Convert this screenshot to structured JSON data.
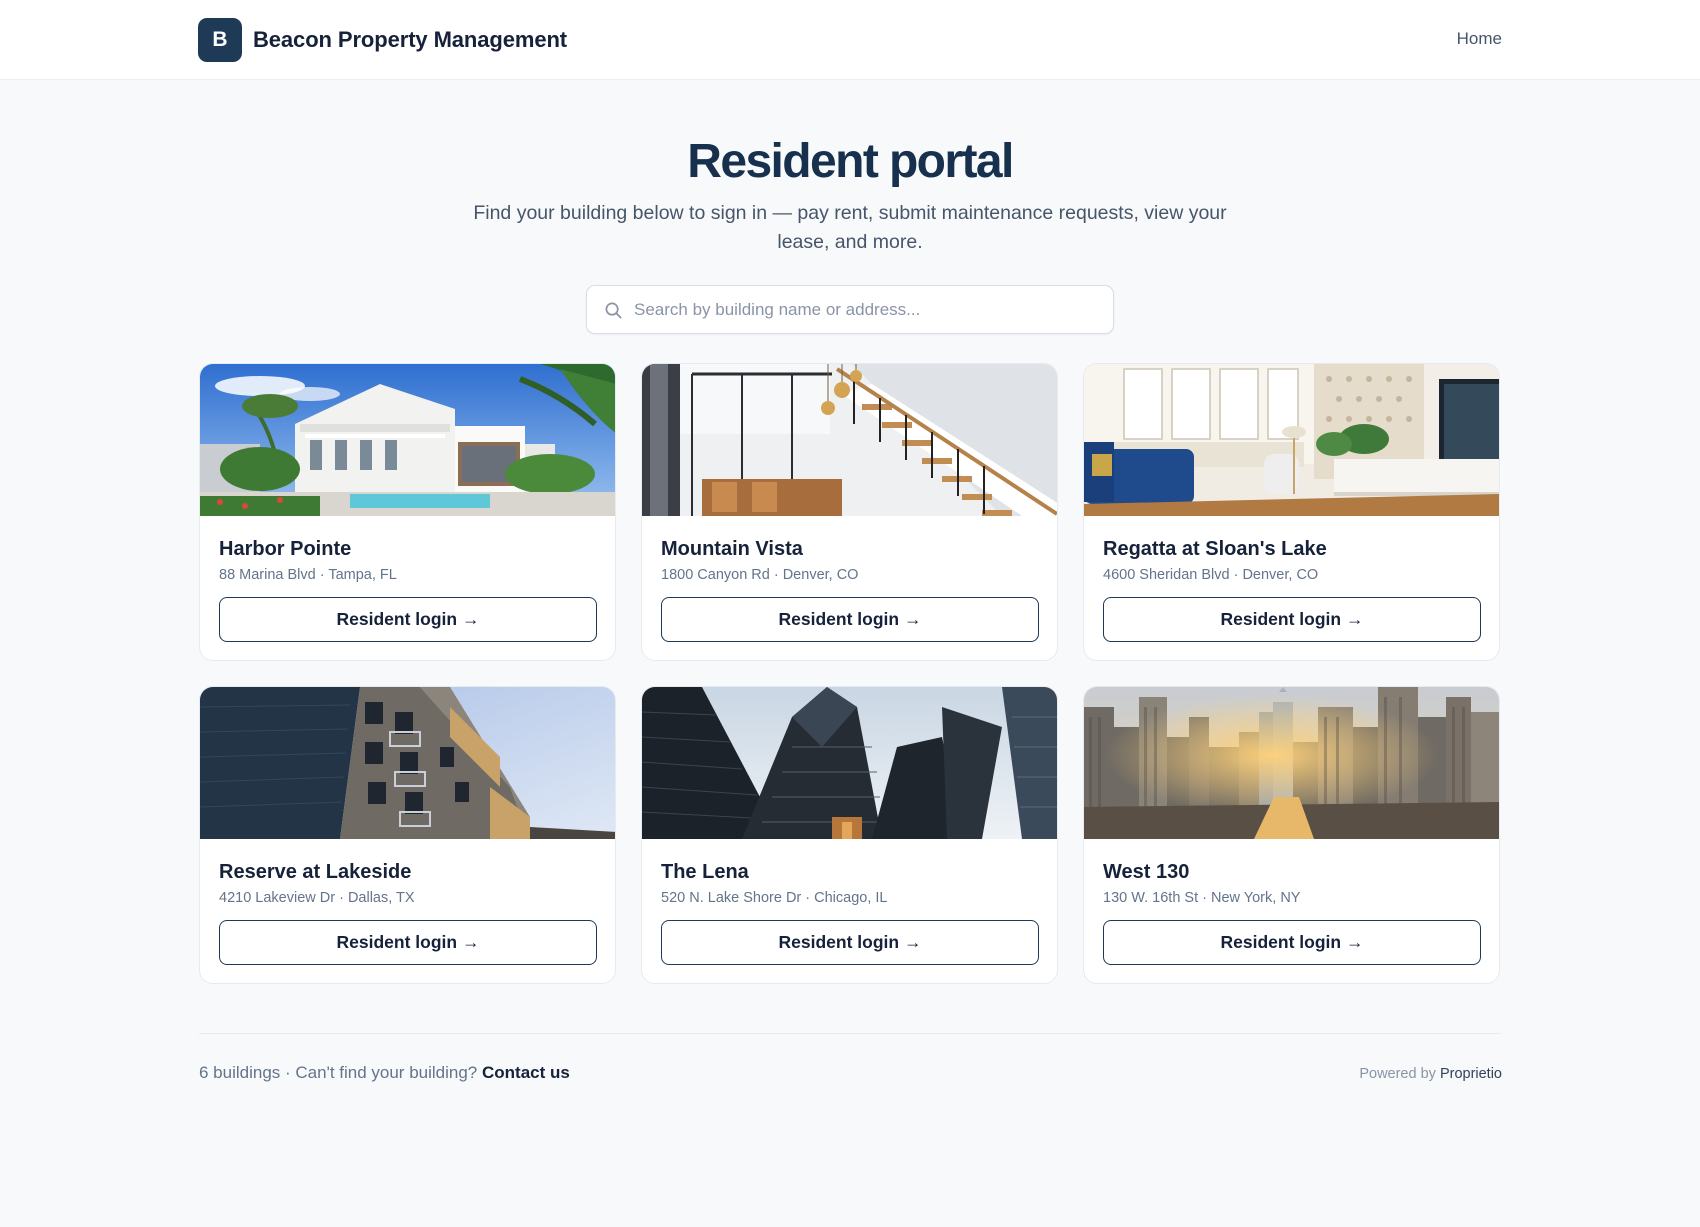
{
  "header": {
    "logo_letter": "B",
    "brand_name": "Beacon Property Management",
    "nav_home": "Home"
  },
  "hero": {
    "title": "Resident portal",
    "subtitle": "Find your building below to sign in — pay rent, submit maintenance requests, view your lease, and more."
  },
  "search": {
    "placeholder": "Search by building name or address...",
    "value": "",
    "icon": "search-icon"
  },
  "buildings": [
    {
      "name": "Harbor Pointe",
      "address": "88 Marina Blvd · Tampa, FL",
      "button": "Resident login →",
      "photo": "white-house-with-pool"
    },
    {
      "name": "Mountain Vista",
      "address": "1800 Canyon Rd · Denver, CO",
      "button": "Resident login →",
      "photo": "interior-staircase"
    },
    {
      "name": "Regatta at Sloan's Lake",
      "address": "4600 Sheridan Blvd · Denver, CO",
      "button": "Resident login →",
      "photo": "living-room"
    },
    {
      "name": "Reserve at Lakeside",
      "address": "4210 Lakeview Dr · Dallas, TX",
      "button": "Resident login →",
      "photo": "apartment-facade"
    },
    {
      "name": "The Lena",
      "address": "520 N. Lake Shore Dr · Chicago, IL",
      "button": "Resident login →",
      "photo": "glass-skyscrapers"
    },
    {
      "name": "West 130",
      "address": "130 W. 16th St · New York, NY",
      "button": "Resident login →",
      "photo": "city-skyline-sunset"
    }
  ],
  "footer": {
    "count_text": "6 buildings · Can't find your building?",
    "contact_link": "Contact us",
    "powered_by": "Powered by",
    "powered_brand": "Proprietio"
  },
  "colors": {
    "brand": "#1e3a56",
    "title": "#16304d",
    "background": "#f8f9fb",
    "muted_text": "#64748b"
  }
}
